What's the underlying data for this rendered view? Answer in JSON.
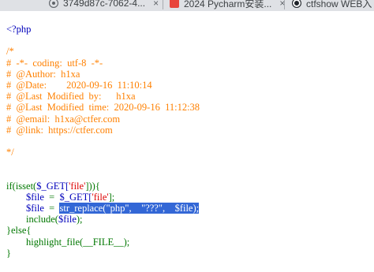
{
  "browser": {
    "tabs": [
      {
        "label": "3749d87c-7062-4...",
        "icon": "globe-icon"
      },
      {
        "label": "2024 Pycharm安装...",
        "icon": "pycharm-icon"
      },
      {
        "label": "ctfshow WEB入",
        "icon": "ctfshow-icon"
      }
    ],
    "close_glyph": "×"
  },
  "code": {
    "open_tag": "<?php",
    "comment": [
      "/*",
      "#  -*-  coding:  utf-8  -*-",
      "#  @Author:  h1xa",
      "#  @Date:        2020-09-16  11:10:14",
      "#  @Last  Modified  by:      h1xa",
      "#  @Last  Modified  time:  2020-09-16  11:12:38",
      "#  @email:  h1xa@ctfer.com",
      "#  @link:  https://ctfer.com",
      "",
      "*/"
    ],
    "if_kw": "if(",
    "isset_fn": "isset(",
    "get_var": "$_GET[",
    "file_key": "'file'",
    "if_close": "])){",
    "indent": "        ",
    "file_var": "$file",
    "assign_op": "  =  ",
    "line1_end": "];",
    "replace_fn": "str_replace(",
    "arg_php": "\"php\"",
    "comma_sep": ",    ",
    "arg_q": "\"???\"",
    "arg_file": "$file",
    "replace_end": ");",
    "include_fn": "include(",
    "include_end": ");",
    "else_kw": "}else{",
    "highlight_fn": "highlight_file(",
    "magic_file": "__FILE__",
    "highlight_end": ");",
    "close_brace": "}",
    "selection_color": "#3367d6"
  }
}
